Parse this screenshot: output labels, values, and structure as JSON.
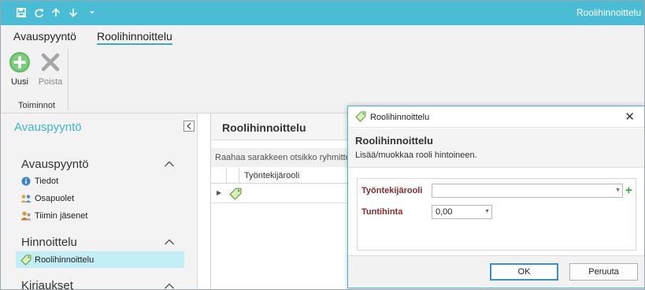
{
  "window": {
    "title": "Roolihinnoittelu"
  },
  "quick_access": [
    "save-icon",
    "refresh-icon",
    "arrow-up-icon",
    "arrow-down-icon",
    "dropdown-icon"
  ],
  "ribbon": {
    "tabs": [
      {
        "label": "Avauspyyntö",
        "active": false
      },
      {
        "label": "Roolihinnoittelu",
        "active": true
      }
    ],
    "buttons": [
      {
        "label": "Uusi",
        "icon": "add-icon",
        "enabled": true
      },
      {
        "label": "Poista",
        "icon": "delete-icon",
        "enabled": false
      }
    ],
    "group_label": "Toiminnot"
  },
  "nav": {
    "title": "Avauspyyntö",
    "sections": [
      {
        "label": "Avauspyyntö",
        "items": [
          {
            "label": "Tiedot",
            "icon": "info-icon"
          },
          {
            "label": "Osapuolet",
            "icon": "parties-icon"
          },
          {
            "label": "Tiimin jäsenet",
            "icon": "team-members-icon"
          }
        ]
      },
      {
        "label": "Hinnoittelu",
        "items": [
          {
            "label": "Roolihinnoittelu",
            "icon": "price-tag-icon",
            "selected": true
          }
        ]
      },
      {
        "label": "Kirjaukset",
        "items": []
      }
    ]
  },
  "panel": {
    "title": "Roolihinnoittelu",
    "group_hint": "Raahaa sarakkeen otsikko ryhmittelyyn",
    "columns": [
      "Työntekijärooli"
    ]
  },
  "dialog": {
    "title": "Roolihinnoittelu",
    "heading": "Roolihinnoittelu",
    "subtitle": "Lisää/muokkaa rooli hintoineen.",
    "fields": {
      "role": {
        "label": "Työntekijärooli",
        "value": ""
      },
      "rate": {
        "label": "Tuntihinta",
        "value": "0,00"
      }
    },
    "ok_label": "OK",
    "cancel_label": "Peruuta"
  },
  "colors": {
    "accent": "#4bbcd6",
    "nav_title": "#3fb3cf",
    "selected": "#c4eef6",
    "required_label": "#8b2a2a",
    "add_green": "#5cb85c"
  }
}
